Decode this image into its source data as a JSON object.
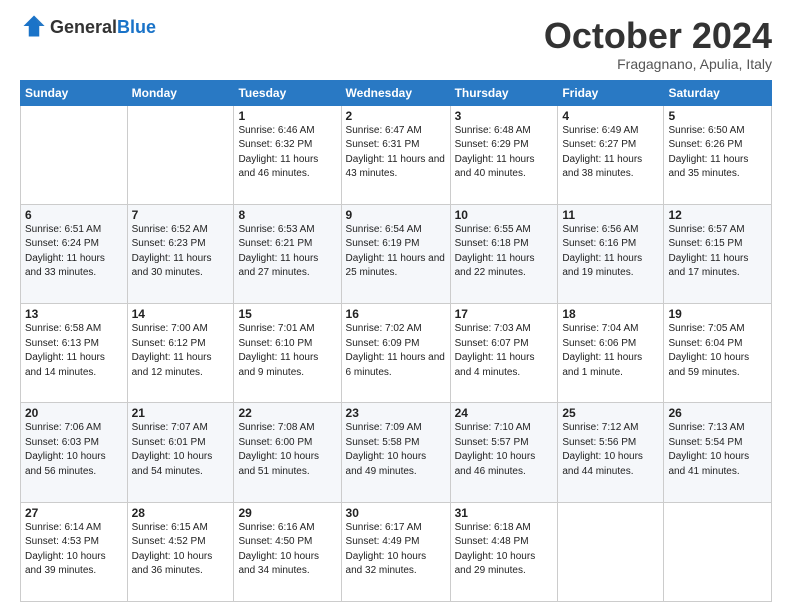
{
  "logo": {
    "general": "General",
    "blue": "Blue"
  },
  "header": {
    "month": "October 2024",
    "location": "Fragagnano, Apulia, Italy"
  },
  "weekdays": [
    "Sunday",
    "Monday",
    "Tuesday",
    "Wednesday",
    "Thursday",
    "Friday",
    "Saturday"
  ],
  "weeks": [
    [
      {
        "day": "",
        "sunrise": "",
        "sunset": "",
        "daylight": ""
      },
      {
        "day": "",
        "sunrise": "",
        "sunset": "",
        "daylight": ""
      },
      {
        "day": "1",
        "sunrise": "Sunrise: 6:46 AM",
        "sunset": "Sunset: 6:32 PM",
        "daylight": "Daylight: 11 hours and 46 minutes."
      },
      {
        "day": "2",
        "sunrise": "Sunrise: 6:47 AM",
        "sunset": "Sunset: 6:31 PM",
        "daylight": "Daylight: 11 hours and 43 minutes."
      },
      {
        "day": "3",
        "sunrise": "Sunrise: 6:48 AM",
        "sunset": "Sunset: 6:29 PM",
        "daylight": "Daylight: 11 hours and 40 minutes."
      },
      {
        "day": "4",
        "sunrise": "Sunrise: 6:49 AM",
        "sunset": "Sunset: 6:27 PM",
        "daylight": "Daylight: 11 hours and 38 minutes."
      },
      {
        "day": "5",
        "sunrise": "Sunrise: 6:50 AM",
        "sunset": "Sunset: 6:26 PM",
        "daylight": "Daylight: 11 hours and 35 minutes."
      }
    ],
    [
      {
        "day": "6",
        "sunrise": "Sunrise: 6:51 AM",
        "sunset": "Sunset: 6:24 PM",
        "daylight": "Daylight: 11 hours and 33 minutes."
      },
      {
        "day": "7",
        "sunrise": "Sunrise: 6:52 AM",
        "sunset": "Sunset: 6:23 PM",
        "daylight": "Daylight: 11 hours and 30 minutes."
      },
      {
        "day": "8",
        "sunrise": "Sunrise: 6:53 AM",
        "sunset": "Sunset: 6:21 PM",
        "daylight": "Daylight: 11 hours and 27 minutes."
      },
      {
        "day": "9",
        "sunrise": "Sunrise: 6:54 AM",
        "sunset": "Sunset: 6:19 PM",
        "daylight": "Daylight: 11 hours and 25 minutes."
      },
      {
        "day": "10",
        "sunrise": "Sunrise: 6:55 AM",
        "sunset": "Sunset: 6:18 PM",
        "daylight": "Daylight: 11 hours and 22 minutes."
      },
      {
        "day": "11",
        "sunrise": "Sunrise: 6:56 AM",
        "sunset": "Sunset: 6:16 PM",
        "daylight": "Daylight: 11 hours and 19 minutes."
      },
      {
        "day": "12",
        "sunrise": "Sunrise: 6:57 AM",
        "sunset": "Sunset: 6:15 PM",
        "daylight": "Daylight: 11 hours and 17 minutes."
      }
    ],
    [
      {
        "day": "13",
        "sunrise": "Sunrise: 6:58 AM",
        "sunset": "Sunset: 6:13 PM",
        "daylight": "Daylight: 11 hours and 14 minutes."
      },
      {
        "day": "14",
        "sunrise": "Sunrise: 7:00 AM",
        "sunset": "Sunset: 6:12 PM",
        "daylight": "Daylight: 11 hours and 12 minutes."
      },
      {
        "day": "15",
        "sunrise": "Sunrise: 7:01 AM",
        "sunset": "Sunset: 6:10 PM",
        "daylight": "Daylight: 11 hours and 9 minutes."
      },
      {
        "day": "16",
        "sunrise": "Sunrise: 7:02 AM",
        "sunset": "Sunset: 6:09 PM",
        "daylight": "Daylight: 11 hours and 6 minutes."
      },
      {
        "day": "17",
        "sunrise": "Sunrise: 7:03 AM",
        "sunset": "Sunset: 6:07 PM",
        "daylight": "Daylight: 11 hours and 4 minutes."
      },
      {
        "day": "18",
        "sunrise": "Sunrise: 7:04 AM",
        "sunset": "Sunset: 6:06 PM",
        "daylight": "Daylight: 11 hours and 1 minute."
      },
      {
        "day": "19",
        "sunrise": "Sunrise: 7:05 AM",
        "sunset": "Sunset: 6:04 PM",
        "daylight": "Daylight: 10 hours and 59 minutes."
      }
    ],
    [
      {
        "day": "20",
        "sunrise": "Sunrise: 7:06 AM",
        "sunset": "Sunset: 6:03 PM",
        "daylight": "Daylight: 10 hours and 56 minutes."
      },
      {
        "day": "21",
        "sunrise": "Sunrise: 7:07 AM",
        "sunset": "Sunset: 6:01 PM",
        "daylight": "Daylight: 10 hours and 54 minutes."
      },
      {
        "day": "22",
        "sunrise": "Sunrise: 7:08 AM",
        "sunset": "Sunset: 6:00 PM",
        "daylight": "Daylight: 10 hours and 51 minutes."
      },
      {
        "day": "23",
        "sunrise": "Sunrise: 7:09 AM",
        "sunset": "Sunset: 5:58 PM",
        "daylight": "Daylight: 10 hours and 49 minutes."
      },
      {
        "day": "24",
        "sunrise": "Sunrise: 7:10 AM",
        "sunset": "Sunset: 5:57 PM",
        "daylight": "Daylight: 10 hours and 46 minutes."
      },
      {
        "day": "25",
        "sunrise": "Sunrise: 7:12 AM",
        "sunset": "Sunset: 5:56 PM",
        "daylight": "Daylight: 10 hours and 44 minutes."
      },
      {
        "day": "26",
        "sunrise": "Sunrise: 7:13 AM",
        "sunset": "Sunset: 5:54 PM",
        "daylight": "Daylight: 10 hours and 41 minutes."
      }
    ],
    [
      {
        "day": "27",
        "sunrise": "Sunrise: 6:14 AM",
        "sunset": "Sunset: 4:53 PM",
        "daylight": "Daylight: 10 hours and 39 minutes."
      },
      {
        "day": "28",
        "sunrise": "Sunrise: 6:15 AM",
        "sunset": "Sunset: 4:52 PM",
        "daylight": "Daylight: 10 hours and 36 minutes."
      },
      {
        "day": "29",
        "sunrise": "Sunrise: 6:16 AM",
        "sunset": "Sunset: 4:50 PM",
        "daylight": "Daylight: 10 hours and 34 minutes."
      },
      {
        "day": "30",
        "sunrise": "Sunrise: 6:17 AM",
        "sunset": "Sunset: 4:49 PM",
        "daylight": "Daylight: 10 hours and 32 minutes."
      },
      {
        "day": "31",
        "sunrise": "Sunrise: 6:18 AM",
        "sunset": "Sunset: 4:48 PM",
        "daylight": "Daylight: 10 hours and 29 minutes."
      },
      {
        "day": "",
        "sunrise": "",
        "sunset": "",
        "daylight": ""
      },
      {
        "day": "",
        "sunrise": "",
        "sunset": "",
        "daylight": ""
      }
    ]
  ]
}
